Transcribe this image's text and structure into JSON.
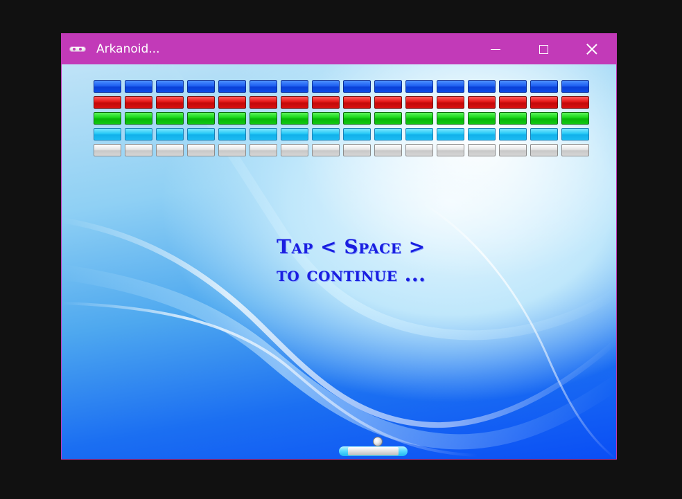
{
  "window": {
    "title": "Arkanoid...",
    "icon": "arkanoid-app-icon",
    "controls": [
      "minimize-icon",
      "maximize-icon",
      "close-icon"
    ],
    "titlebar_color": "#c23ab8"
  },
  "game": {
    "brick_rows": [
      {
        "color": "blue",
        "count": 16
      },
      {
        "color": "red",
        "count": 16
      },
      {
        "color": "green",
        "count": 16
      },
      {
        "color": "cyan",
        "count": 16
      },
      {
        "color": "silver",
        "count": 16
      }
    ],
    "message_line1": "Tap < Space >",
    "message_line2": "to continue ...",
    "message_color": "#1a1ee0"
  }
}
